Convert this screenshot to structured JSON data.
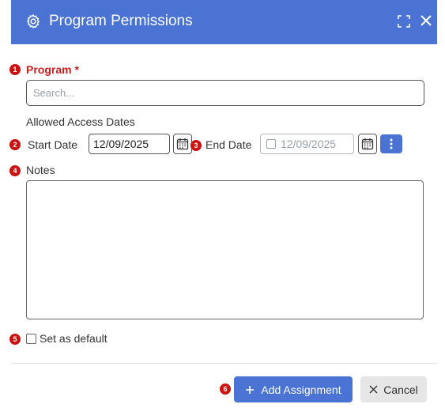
{
  "dialog": {
    "title": "Program Permissions"
  },
  "badges": [
    "1",
    "2",
    "3",
    "4",
    "5",
    "6"
  ],
  "program": {
    "label": "Program *",
    "placeholder": "Search..."
  },
  "access_dates": {
    "heading": "Allowed Access Dates",
    "start_label": "Start Date",
    "start_value": "12/09/2025",
    "end_label": "End Date",
    "end_value": "12/09/2025"
  },
  "notes": {
    "label": "Notes",
    "value": ""
  },
  "default_checkbox": {
    "label": "Set as default",
    "checked": false
  },
  "footer": {
    "add_label": "Add Assignment",
    "cancel_label": "Cancel"
  },
  "colors": {
    "primary": "#4a73d4",
    "badge": "#cc1111",
    "required_label": "#c81e1e"
  }
}
